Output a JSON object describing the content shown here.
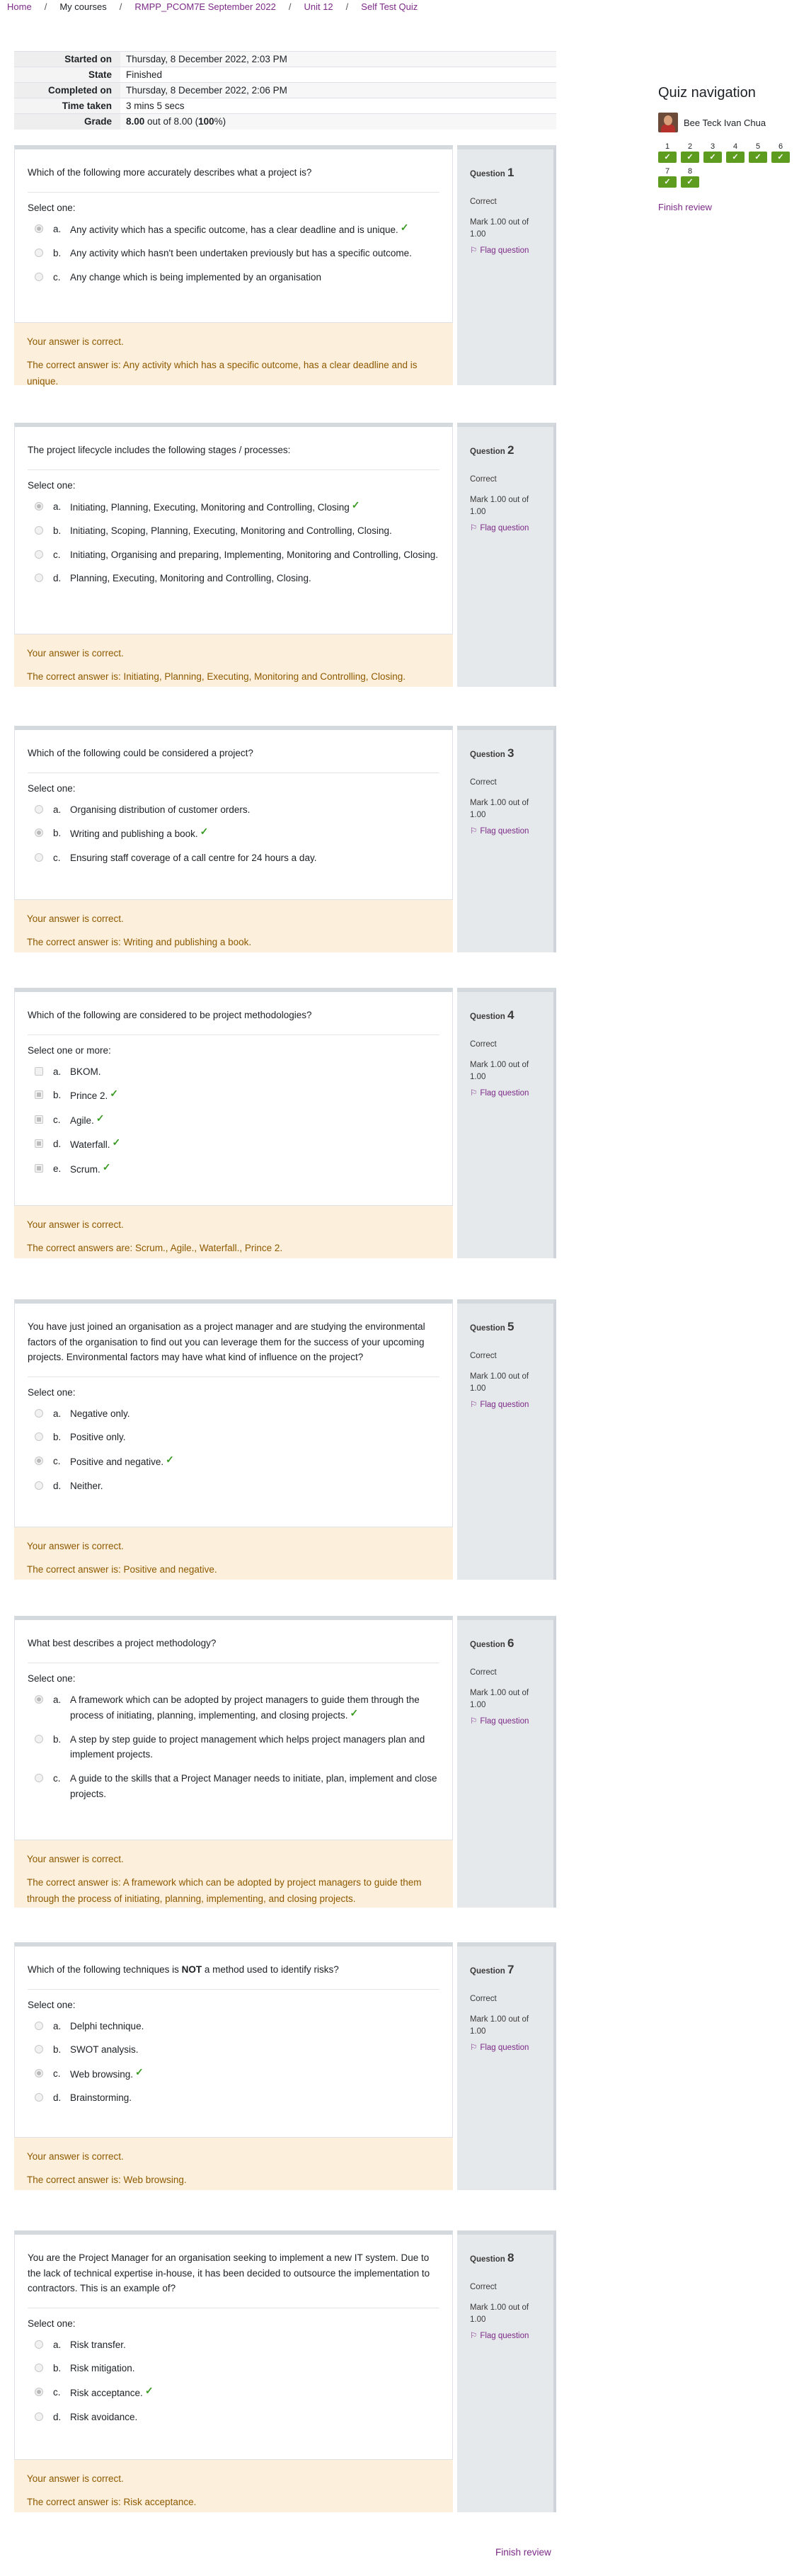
{
  "breadcrumb": [
    {
      "label": "Home",
      "link": true
    },
    {
      "label": "My courses",
      "link": false
    },
    {
      "label": "RMPP_PCOM7E September 2022",
      "link": true
    },
    {
      "label": "Unit 12",
      "link": true
    },
    {
      "label": "Self Test Quiz",
      "link": true
    }
  ],
  "summary": {
    "started_label": "Started on",
    "started": "Thursday, 8 December 2022, 2:03 PM",
    "state_label": "State",
    "state": "Finished",
    "completed_label": "Completed on",
    "completed": "Thursday, 8 December 2022, 2:06 PM",
    "time_label": "Time taken",
    "time": "3 mins 5 secs",
    "grade_label": "Grade",
    "grade_score": "8.00",
    "grade_mid": " out of 8.00 (",
    "grade_pct": "100",
    "grade_end": "%)"
  },
  "labels": {
    "select_one": "Select one:",
    "select_more": "Select one or more:",
    "question": "Question",
    "state": "Correct",
    "mark": "Mark 1.00 out of 1.00",
    "flag": "Flag question",
    "your_answer": "Your answer is correct.",
    "finish_review": "Finish review"
  },
  "questions": [
    {
      "num": "1",
      "text": "Which of the following more accurately describes what a project is?",
      "answers": [
        {
          "letter": "a.",
          "text": "Any activity which has a specific outcome, has a clear deadline and is unique.",
          "checked": true,
          "tick": true
        },
        {
          "letter": "b.",
          "text": "Any activity which hasn't been undertaken previously but has a specific outcome.",
          "checked": false,
          "tick": false
        },
        {
          "letter": "c.",
          "text": "Any change which is being implemented by an organisation",
          "checked": false,
          "tick": false
        }
      ],
      "correct": "The correct answer is: Any activity which has a specific outcome, has a clear deadline and is unique."
    },
    {
      "num": "2",
      "text": "The project lifecycle includes the following stages / processes:",
      "answers": [
        {
          "letter": "a.",
          "text": "Initiating, Planning, Executing, Monitoring and Controlling, Closing",
          "checked": true,
          "tick": true
        },
        {
          "letter": "b.",
          "text": "Initiating, Scoping, Planning, Executing, Monitoring and Controlling, Closing.",
          "checked": false,
          "tick": false
        },
        {
          "letter": "c.",
          "text": "Initiating, Organising and preparing, Implementing, Monitoring and Controlling, Closing.",
          "checked": false,
          "tick": false
        },
        {
          "letter": "d.",
          "text": "Planning, Executing, Monitoring and Controlling, Closing.",
          "checked": false,
          "tick": false
        }
      ],
      "correct": "The correct answer is: Initiating, Planning, Executing, Monitoring and Controlling, Closing."
    },
    {
      "num": "3",
      "text": "Which of the following could be considered a project?",
      "answers": [
        {
          "letter": "a.",
          "text": "Organising distribution of customer orders.",
          "checked": false,
          "tick": false
        },
        {
          "letter": "b.",
          "text": "Writing and publishing a book.",
          "checked": true,
          "tick": true
        },
        {
          "letter": "c.",
          "text": "Ensuring staff coverage of a call centre for 24 hours a day.",
          "checked": false,
          "tick": false
        }
      ],
      "correct": "The correct answer is: Writing and publishing a book."
    },
    {
      "num": "4",
      "text": "Which of the following are considered to be project methodologies?",
      "multi": true,
      "answers": [
        {
          "letter": "a.",
          "text": "BKOM.",
          "checked": false,
          "tick": false
        },
        {
          "letter": "b.",
          "text": "Prince 2.",
          "checked": true,
          "tick": true
        },
        {
          "letter": "c.",
          "text": "Agile.",
          "checked": true,
          "tick": true
        },
        {
          "letter": "d.",
          "text": "Waterfall.",
          "checked": true,
          "tick": true
        },
        {
          "letter": "e.",
          "text": "Scrum.",
          "checked": true,
          "tick": true
        }
      ],
      "correct": "The correct answers are: Scrum., Agile., Waterfall., Prince 2."
    },
    {
      "num": "5",
      "text": "You have just joined an organisation as a project manager and are studying the environmental factors of the organisation to find out you can leverage them for the success of your upcoming projects. Environmental factors may have what kind of influence on the project?",
      "answers": [
        {
          "letter": "a.",
          "text": "Negative only.",
          "checked": false,
          "tick": false
        },
        {
          "letter": "b.",
          "text": "Positive only.",
          "checked": false,
          "tick": false
        },
        {
          "letter": "c.",
          "text": "Positive and negative.",
          "checked": true,
          "tick": true
        },
        {
          "letter": "d.",
          "text": "Neither.",
          "checked": false,
          "tick": false
        }
      ],
      "correct": "The correct answer is: Positive and negative."
    },
    {
      "num": "6",
      "text": "What best describes a project methodology?",
      "answers": [
        {
          "letter": "a.",
          "text": "A framework which can be adopted by project managers to guide them through the process of initiating, planning, implementing, and closing projects.",
          "checked": true,
          "tick": true
        },
        {
          "letter": "b.",
          "text": "A step by step guide to project management which helps project managers plan and implement projects.",
          "checked": false,
          "tick": false
        },
        {
          "letter": "c.",
          "text": "A guide to the skills that a Project Manager needs to initiate, plan, implement and close projects.",
          "checked": false,
          "tick": false
        }
      ],
      "correct": "The correct answer is: A framework which can be adopted by project managers to guide them through the process of initiating, planning, implementing, and closing projects."
    },
    {
      "num": "7",
      "text_pre": "Which of the following techniques is ",
      "text_bold": "NOT",
      "text_post": " a method used to identify risks?",
      "answers": [
        {
          "letter": "a.",
          "text": "Delphi technique.",
          "checked": false,
          "tick": false
        },
        {
          "letter": "b.",
          "text": "SWOT analysis.",
          "checked": false,
          "tick": false
        },
        {
          "letter": "c.",
          "text": "Web browsing.",
          "checked": true,
          "tick": true
        },
        {
          "letter": "d.",
          "text": "Brainstorming.",
          "checked": false,
          "tick": false
        }
      ],
      "correct": "The correct answer is: Web browsing."
    },
    {
      "num": "8",
      "text": "You are the Project Manager for an organisation seeking to implement a new IT system.  Due to the lack of technical expertise in-house, it has been decided to outsource the implementation to contractors. This is an example of?",
      "answers": [
        {
          "letter": "a.",
          "text": "Risk transfer.",
          "checked": false,
          "tick": false
        },
        {
          "letter": "b.",
          "text": "Risk mitigation.",
          "checked": false,
          "tick": false
        },
        {
          "letter": "c.",
          "text": "Risk acceptance.",
          "checked": true,
          "tick": true
        },
        {
          "letter": "d.",
          "text": "Risk avoidance.",
          "checked": false,
          "tick": false
        }
      ],
      "correct": "The correct answer is: Risk acceptance."
    }
  ],
  "nav": {
    "title": "Quiz navigation",
    "user": "Bee Teck Ivan Chua",
    "buttons": [
      "1",
      "2",
      "3",
      "4",
      "5",
      "6",
      "7",
      "8"
    ],
    "tick_glyph": "✓",
    "finish": "Finish review"
  }
}
